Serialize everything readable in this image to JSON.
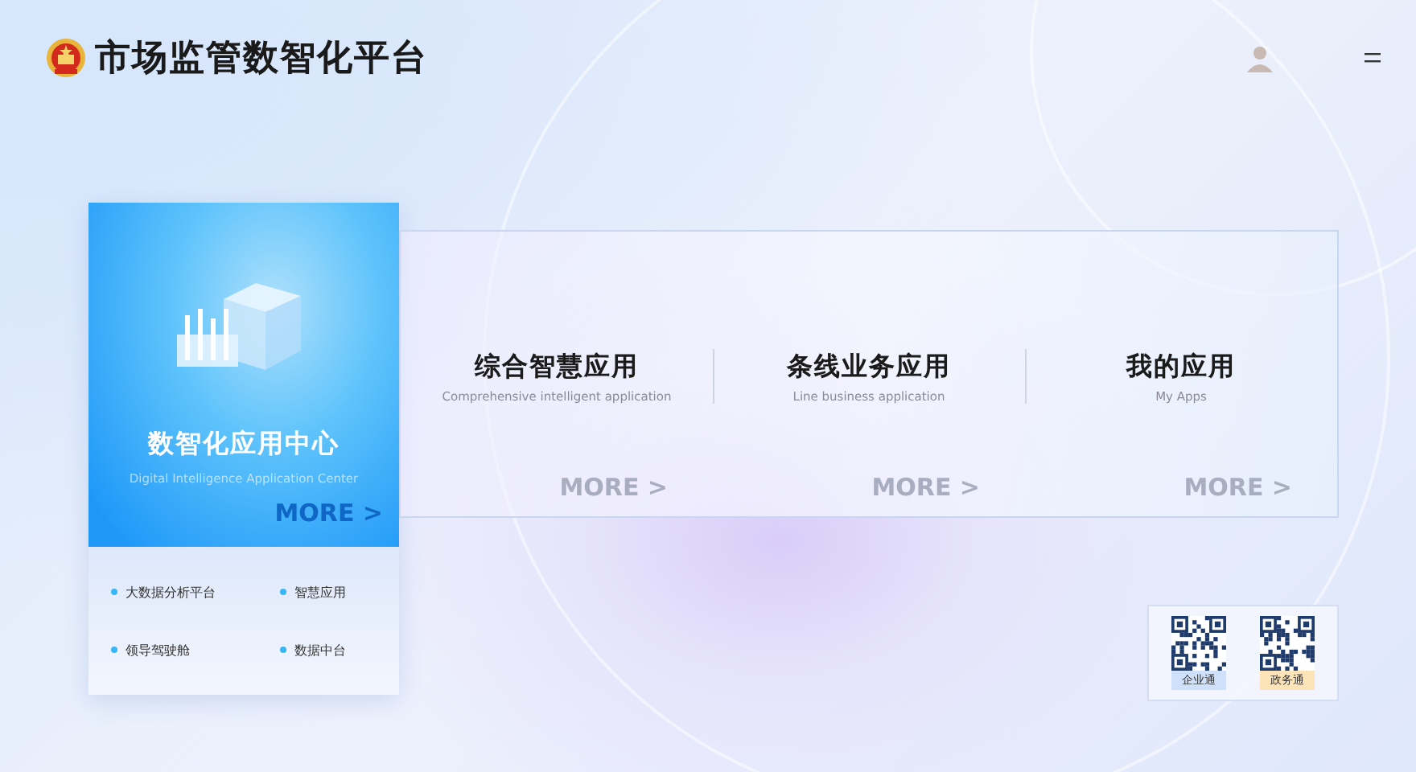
{
  "header": {
    "title": "市场监管数智化平台"
  },
  "center": {
    "title": "数智化应用中心",
    "subtitle": "Digital Intelligence Application Center",
    "more": "MORE >",
    "links": [
      "大数据分析平台",
      "智慧应用",
      "领导驾驶舱",
      "数据中台"
    ]
  },
  "apps": [
    {
      "title": "综合智慧应用",
      "subtitle": "Comprehensive intelligent application",
      "more": "MORE >"
    },
    {
      "title": "条线业务应用",
      "subtitle": "Line business application",
      "more": "MORE >"
    },
    {
      "title": "我的应用",
      "subtitle": "My Apps",
      "more": "MORE >"
    }
  ],
  "qr_codes": [
    {
      "label": "企业通",
      "color": "#cfe0fb"
    },
    {
      "label": "政务通",
      "color": "#fde3b8"
    }
  ]
}
